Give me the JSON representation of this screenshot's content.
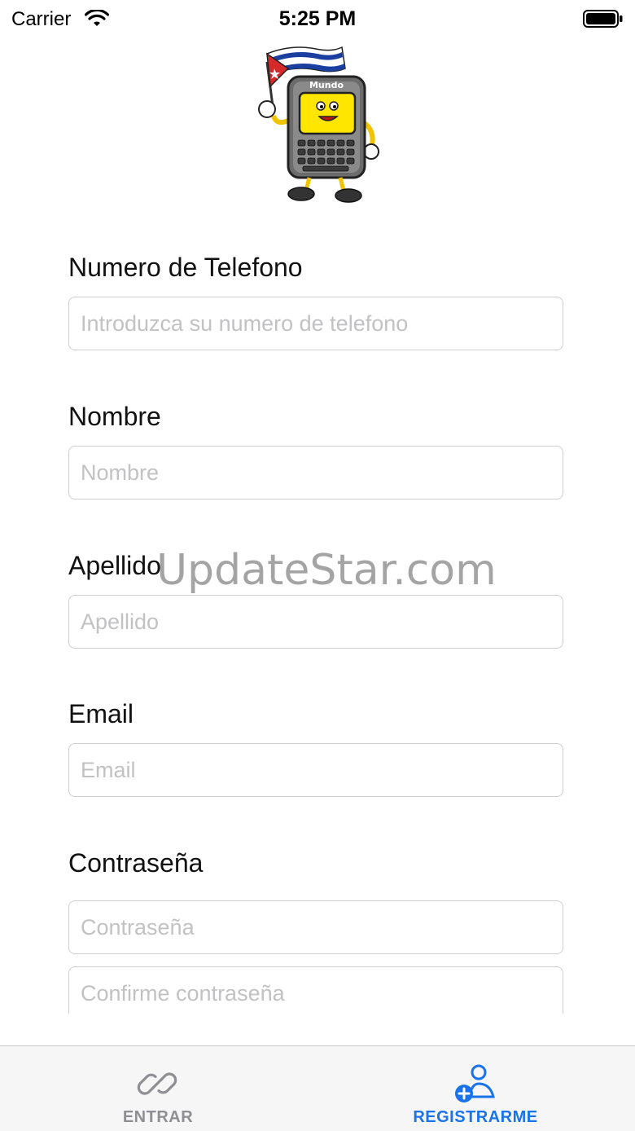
{
  "status_bar": {
    "carrier": "Carrier",
    "time": "5:25 PM"
  },
  "logo": {
    "icon": "mundo-phone-mascot-icon",
    "text": "Mundo"
  },
  "form": {
    "phone": {
      "label": "Numero de Telefono",
      "placeholder": "Introduzca su numero de telefono"
    },
    "first_name": {
      "label": "Nombre",
      "placeholder": "Nombre"
    },
    "last_name": {
      "label": "Apellido",
      "placeholder": "Apellido"
    },
    "email": {
      "label": "Email",
      "placeholder": "Email"
    },
    "password": {
      "label": "Contraseña",
      "placeholder": "Contraseña",
      "confirm_placeholder": "Confirme contraseña"
    }
  },
  "watermark": "UpdateStar.com",
  "tab_bar": {
    "tabs": [
      {
        "label": "ENTRAR",
        "icon": "link-icon",
        "active": false
      },
      {
        "label": "REGISTRARME",
        "icon": "add-user-icon",
        "active": true
      }
    ]
  },
  "colors": {
    "active_tab": "#1a73e8",
    "inactive_tab": "#8e8e93",
    "input_border": "#cfcfcf",
    "placeholder": "#c2c2c4"
  }
}
